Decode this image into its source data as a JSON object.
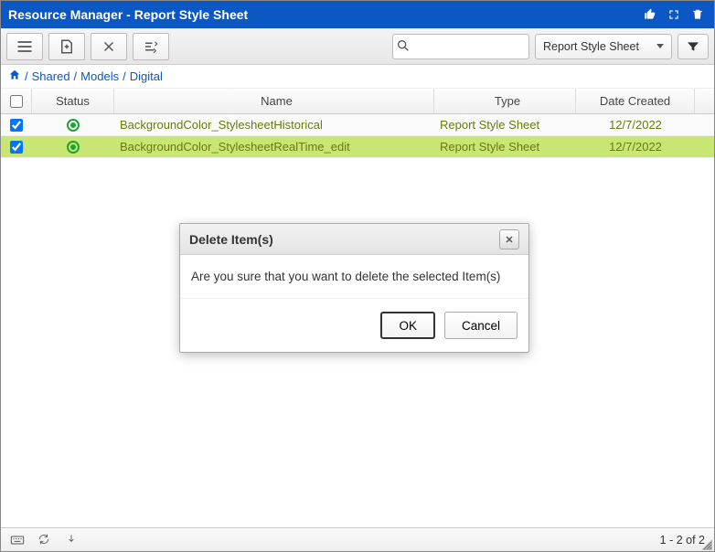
{
  "title": "Resource Manager - Report Style Sheet",
  "dropdown_label": "Report Style Sheet",
  "search_placeholder": "",
  "breadcrumb": {
    "home_title": "Home",
    "parts": [
      "Shared",
      "Models",
      "Digital"
    ]
  },
  "columns": {
    "status": "Status",
    "name": "Name",
    "type": "Type",
    "date": "Date Created"
  },
  "rows": [
    {
      "checked": true,
      "selected": false,
      "name": "BackgroundColor_StylesheetHistorical",
      "type": "Report Style Sheet",
      "date": "12/7/2022"
    },
    {
      "checked": true,
      "selected": true,
      "name": "BackgroundColor_StylesheetRealTime_edit",
      "type": "Report Style Sheet",
      "date": "12/7/2022"
    }
  ],
  "pager": "1 - 2 of 2",
  "dialog": {
    "title": "Delete Item(s)",
    "message": "Are you sure that you want to delete the selected Item(s)",
    "ok": "OK",
    "cancel": "Cancel"
  }
}
